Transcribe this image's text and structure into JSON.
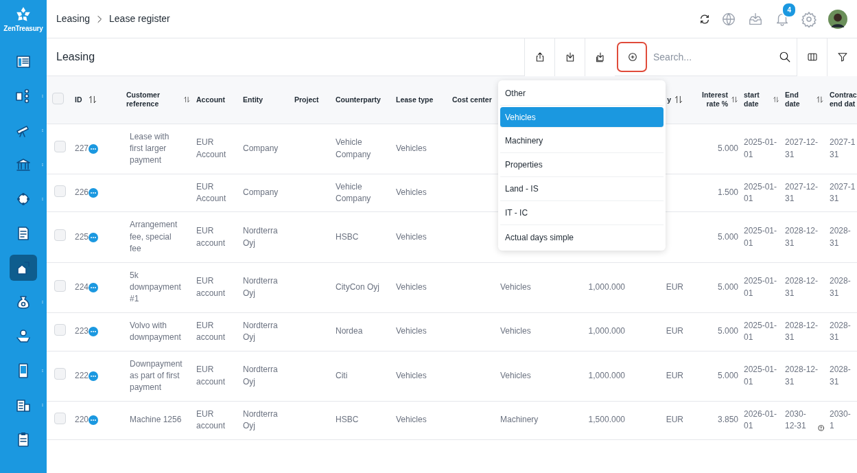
{
  "app": {
    "logo_text": "ZenTreasury"
  },
  "sidebar": {
    "items": [
      {
        "selected": false,
        "has_menu": false
      },
      {
        "selected": false,
        "has_menu": true
      },
      {
        "selected": false,
        "has_menu": true
      },
      {
        "selected": false,
        "has_menu": true
      },
      {
        "selected": false,
        "has_menu": true
      },
      {
        "selected": false,
        "has_menu": false
      },
      {
        "selected": true,
        "has_menu": false
      },
      {
        "selected": false,
        "has_menu": true
      },
      {
        "selected": false,
        "has_menu": false
      },
      {
        "selected": false,
        "has_menu": true
      },
      {
        "selected": false,
        "has_menu": true
      },
      {
        "selected": false,
        "has_menu": false
      }
    ]
  },
  "breadcrumb": [
    "Leasing",
    "Lease register"
  ],
  "header": {
    "notifications": "4"
  },
  "toolbar": {
    "title": "Leasing",
    "buttons": [
      {
        "highlighted": false
      },
      {
        "highlighted": false
      },
      {
        "highlighted": false
      },
      {
        "highlighted": true
      }
    ],
    "search": {
      "placeholder": "Search..."
    }
  },
  "table": {
    "select_all": false,
    "columns": [
      {
        "label": "ID",
        "sortable": true
      },
      {
        "label": "Customer reference",
        "sortable": true
      },
      {
        "label": "Account",
        "sortable": false
      },
      {
        "label": "Entity",
        "sortable": false
      },
      {
        "label": "Project",
        "sortable": false
      },
      {
        "label": "Counterparty",
        "sortable": false
      },
      {
        "label": "Lease type",
        "sortable": false
      },
      {
        "label": "Cost center",
        "sortable": false
      },
      {
        "sortable": false
      },
      {
        "sortable": false
      },
      {
        "label": "y",
        "sortable": true
      },
      {
        "label": "Interest rate %",
        "sortable": true
      },
      {
        "label": "start date",
        "sortable": true
      },
      {
        "label": "End date",
        "sortable": true
      },
      {
        "label": "Contrac\nend dat",
        "sortable": false
      }
    ],
    "rows": [
      {
        "checked": false,
        "help_icon": false,
        "cells": [
          "227",
          "Lease with first larger payment",
          "EUR Account",
          "Company",
          "",
          "Vehicle Company",
          "Vehicles",
          "",
          null,
          null,
          null,
          "5.000",
          "2025-01-01",
          "2027-12-31",
          "2027-1\n31"
        ]
      },
      {
        "checked": false,
        "help_icon": false,
        "cells": [
          "226",
          "",
          "EUR Account",
          "Company",
          "",
          "Vehicle Company",
          "Vehicles",
          "",
          null,
          null,
          null,
          "1.500",
          "2025-01-01",
          "2027-12-31",
          "2027-1\n31"
        ]
      },
      {
        "checked": false,
        "help_icon": false,
        "cells": [
          "225",
          "Arrangement fee, special fee",
          "EUR account",
          "Nordterra Oyj",
          "",
          "HSBC",
          "Vehicles",
          "",
          null,
          null,
          null,
          "5.000",
          "2025-01-01",
          "2028-12-31",
          "2028-\n31"
        ]
      },
      {
        "checked": false,
        "help_icon": false,
        "cells": [
          "224",
          "5k downpayment #1",
          "EUR account",
          "Nordterra Oyj",
          "",
          "CityCon Oyj",
          "Vehicles",
          "",
          "Vehicles",
          "1,000.000",
          "EUR",
          "5.000",
          "2025-01-01",
          "2028-12-31",
          "2028-\n31"
        ]
      },
      {
        "checked": false,
        "help_icon": false,
        "cells": [
          "223",
          "Volvo with downpayment",
          "EUR account",
          "Nordterra Oyj",
          "",
          "Nordea",
          "Vehicles",
          "",
          "Vehicles",
          "1,000.000",
          "EUR",
          "5.000",
          "2025-01-01",
          "2028-12-31",
          "2028-\n31"
        ]
      },
      {
        "checked": false,
        "help_icon": false,
        "cells": [
          "222",
          "Downpayment as part of first payment",
          "EUR account",
          "Nordterra Oyj",
          "",
          "Citi",
          "Vehicles",
          "",
          "Vehicles",
          "1,000.000",
          "EUR",
          "5.000",
          "2025-01-01",
          "2028-12-31",
          "2028-\n31"
        ]
      },
      {
        "checked": false,
        "help_icon": true,
        "cells": [
          "220",
          "Machine 1256",
          "EUR account",
          "Nordterra Oyj",
          "",
          "HSBC",
          "Vehicles",
          "",
          "Machinery",
          "1,500.000",
          "EUR",
          "3.850",
          "2026-01-01",
          "2030-12-31",
          "2030-\n1"
        ]
      }
    ]
  },
  "dropdown": {
    "items": [
      {
        "label": "Other",
        "selected": false
      },
      {
        "label": "Vehicles",
        "selected": true
      },
      {
        "label": "Machinery",
        "selected": false
      },
      {
        "label": "Properties",
        "selected": false
      },
      {
        "label": "Land - IS",
        "selected": false
      },
      {
        "label": "IT - IC",
        "selected": false
      },
      {
        "label": "Actual days simple",
        "selected": false
      }
    ]
  }
}
